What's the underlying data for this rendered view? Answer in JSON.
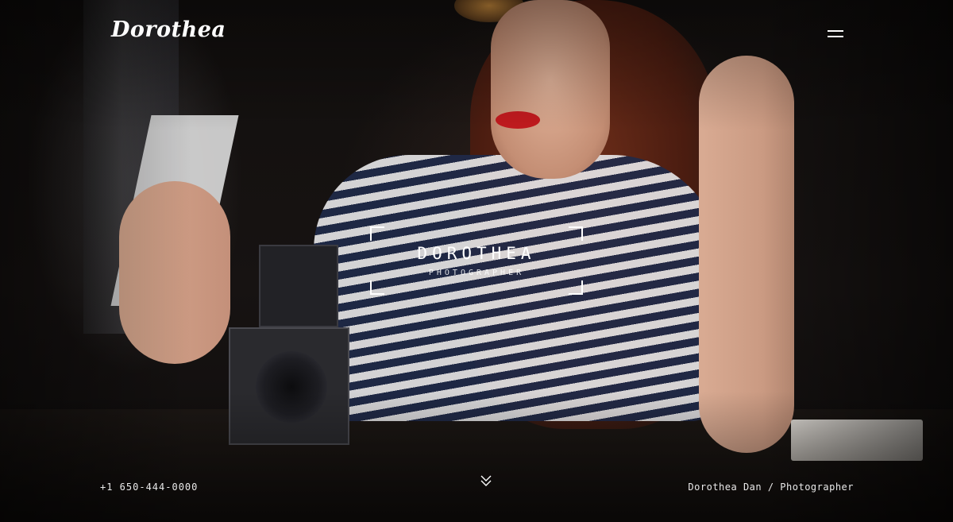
{
  "header": {
    "logo_text": "Dorothea",
    "menu_icon": "hamburger-icon"
  },
  "hero": {
    "brand_name": "DOROTHEA",
    "brand_subtitle": "PHOTOGRAPHER",
    "background_image": "woman-with-camera-photo"
  },
  "footer": {
    "phone": "+1 650-444-0000",
    "scroll_icon": "chevron-double-down-icon",
    "credit": "Dorothea Dan / Photographer"
  },
  "colors": {
    "text": "#ffffff",
    "background": "#0b0a0a"
  }
}
